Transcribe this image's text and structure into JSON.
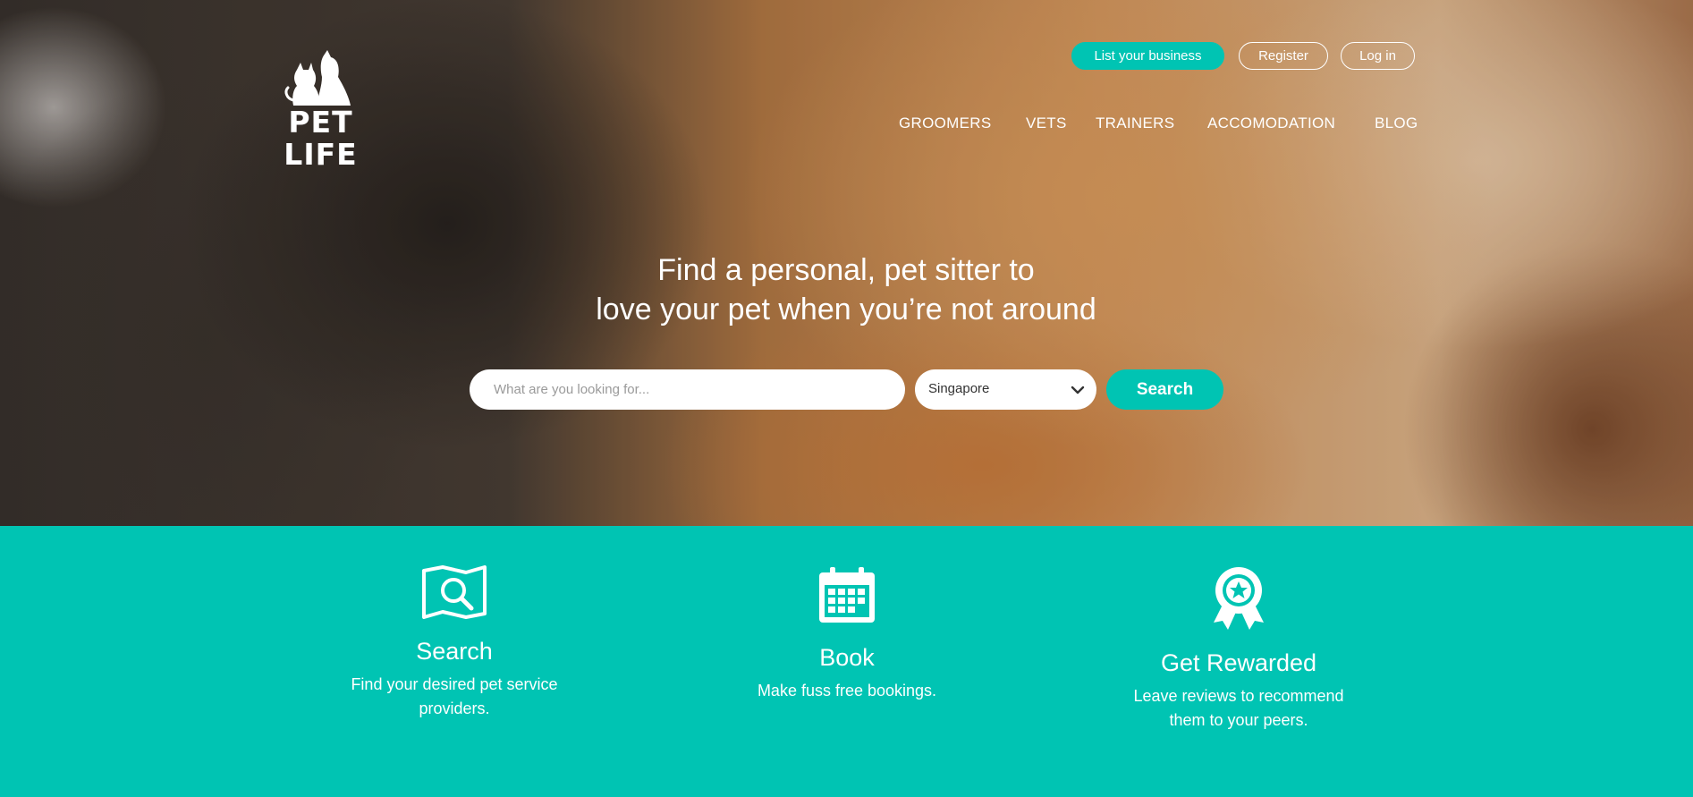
{
  "brand": {
    "name": "PET LIFE",
    "logo_icon": "cat-and-dog-icon"
  },
  "header": {
    "buttons": {
      "list_business": "List your business",
      "register": "Register",
      "login": "Log in"
    },
    "nav": [
      "GROOMERS",
      "VETS",
      "TRAINERS",
      "ACCOMODATION",
      "BLOG"
    ]
  },
  "hero": {
    "headline_line1": "Find a personal, pet sitter to",
    "headline_line2": "love your pet when you’re not around"
  },
  "search": {
    "placeholder": "What are you looking for...",
    "value": "",
    "location": "Singapore",
    "button_label": "Search"
  },
  "features": [
    {
      "icon": "map-search-icon",
      "title": "Search",
      "description": "Find your desired pet service providers."
    },
    {
      "icon": "calendar-icon",
      "title": "Book",
      "description": "Make fuss free bookings."
    },
    {
      "icon": "award-ribbon-icon",
      "title": "Get Rewarded",
      "description": "Leave reviews to recommend them to your peers."
    }
  ],
  "colors": {
    "accent": "#00c4b3",
    "white": "#ffffff"
  }
}
